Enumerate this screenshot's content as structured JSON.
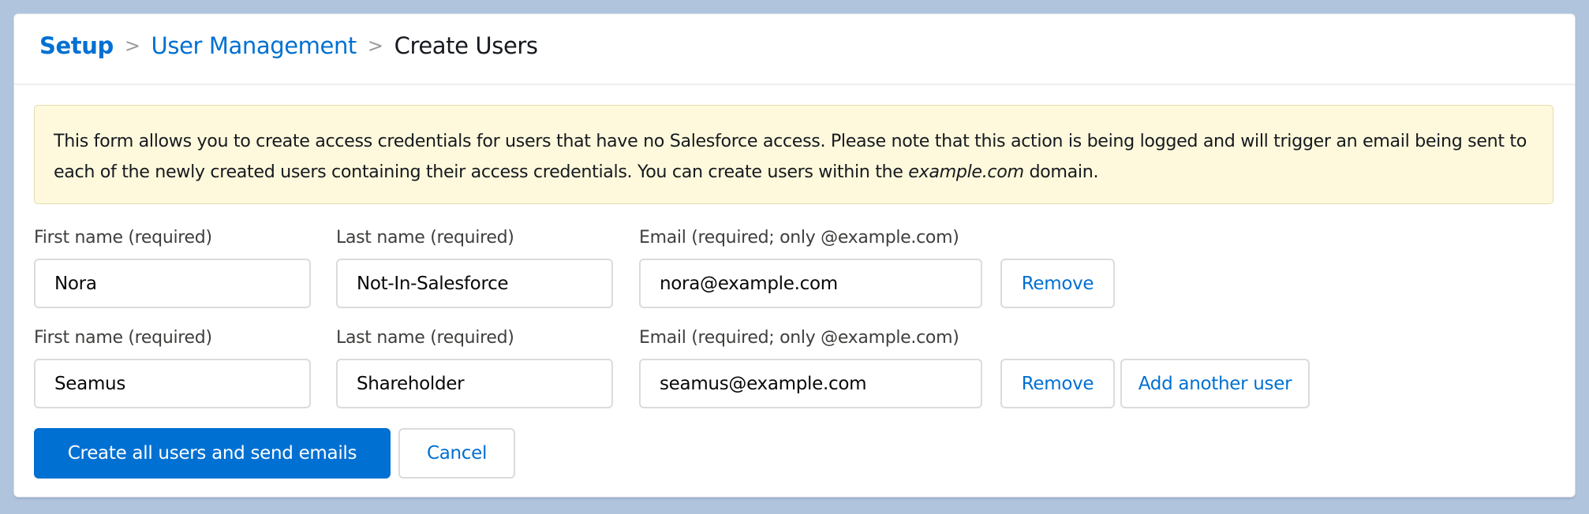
{
  "colors": {
    "page_background": "#b0c4de",
    "brand": "#0070d2",
    "notice_background": "#fef9dc",
    "notice_border": "#e3dbae"
  },
  "breadcrumb": {
    "items": [
      {
        "label": "Setup"
      },
      {
        "label": "User Management"
      },
      {
        "label": "Create Users"
      }
    ],
    "separator": ">"
  },
  "notice": {
    "text_before": "This form allows you to create access credentials for users that have no Salesforce access. Please note that this action is being logged and will trigger an email being sent to each of the newly created users containing their access credentials. You can create users within the ",
    "domain": "example.com",
    "text_after": " domain."
  },
  "form": {
    "labels": {
      "first_name": "First name (required)",
      "last_name": "Last name (required)",
      "email": "Email (required; only @example.com)"
    },
    "users": [
      {
        "first_name": "Nora",
        "last_name": "Not-In-Salesforce",
        "email": "nora@example.com",
        "remove_label": "Remove"
      },
      {
        "first_name": "Seamus",
        "last_name": "Shareholder",
        "email": "seamus@example.com",
        "remove_label": "Remove"
      }
    ],
    "add_user_label": "Add another user"
  },
  "actions": {
    "submit_label": "Create all users and send emails",
    "cancel_label": "Cancel"
  }
}
